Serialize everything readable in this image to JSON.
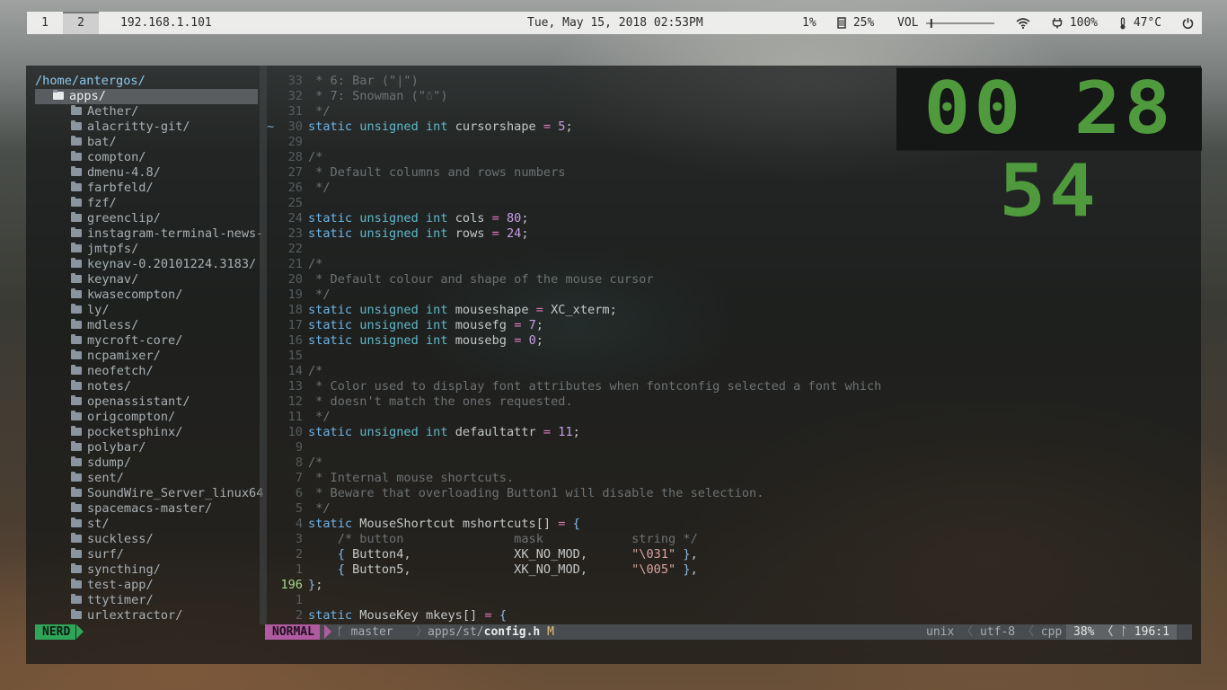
{
  "topbar": {
    "workspaces": [
      "1",
      "2"
    ],
    "active_workspace": "2",
    "ip": "192.168.1.101",
    "datetime": "Tue, May 15, 2018 02:53PM",
    "cpu": "1%",
    "memory": "25%",
    "volume_label": "VOL",
    "volume_level": 0.05,
    "battery": "100%",
    "temperature": "47°C"
  },
  "clock": {
    "time": "00 28 54"
  },
  "tree": {
    "root": "/home/antergos/",
    "selected": "apps/",
    "items": [
      "Aether/",
      "alacritty-git/",
      "bat/",
      "compton/",
      "dmenu-4.8/",
      "farbfeld/",
      "fzf/",
      "greenclip/",
      "instagram-terminal-news-",
      "jmtpfs/",
      "keynav-0.20101224.3183/",
      "keynav/",
      "kwasecompton/",
      "ly/",
      "mdless/",
      "mycroft-core/",
      "ncpamixer/",
      "neofetch/",
      "notes/",
      "openassistant/",
      "origcompton/",
      "pocketsphinx/",
      "polybar/",
      "sdump/",
      "sent/",
      "SoundWire_Server_linux64",
      "spacemacs-master/",
      "st/",
      "suckless/",
      "surf/",
      "syncthing/",
      "test-app/",
      "ttytimer/",
      "urlextractor/"
    ]
  },
  "editor": {
    "lines": [
      {
        "n": "33",
        "text": " * 6: Bar (\"|\")"
      },
      {
        "n": "32",
        "text": " * 7: Snowman (\"☃\")"
      },
      {
        "n": "31",
        "text": " */"
      },
      {
        "n": "30",
        "text": "static unsigned int cursorshape = 5;"
      },
      {
        "n": "29",
        "text": ""
      },
      {
        "n": "28",
        "text": "/*"
      },
      {
        "n": "27",
        "text": " * Default columns and rows numbers"
      },
      {
        "n": "26",
        "text": " */"
      },
      {
        "n": "25",
        "text": ""
      },
      {
        "n": "24",
        "text": "static unsigned int cols = 80;"
      },
      {
        "n": "23",
        "text": "static unsigned int rows = 24;"
      },
      {
        "n": "22",
        "text": ""
      },
      {
        "n": "21",
        "text": "/*"
      },
      {
        "n": "20",
        "text": " * Default colour and shape of the mouse cursor"
      },
      {
        "n": "19",
        "text": " */"
      },
      {
        "n": "18",
        "text": "static unsigned int mouseshape = XC_xterm;"
      },
      {
        "n": "17",
        "text": "static unsigned int mousefg = 7;"
      },
      {
        "n": "16",
        "text": "static unsigned int mousebg = 0;"
      },
      {
        "n": "15",
        "text": ""
      },
      {
        "n": "14",
        "text": "/*"
      },
      {
        "n": "13",
        "text": " * Color used to display font attributes when fontconfig selected a font which"
      },
      {
        "n": "12",
        "text": " * doesn't match the ones requested."
      },
      {
        "n": "11",
        "text": " */"
      },
      {
        "n": "10",
        "text": "static unsigned int defaultattr = 11;"
      },
      {
        "n": "9",
        "text": ""
      },
      {
        "n": "8",
        "text": "/*"
      },
      {
        "n": "7",
        "text": " * Internal mouse shortcuts."
      },
      {
        "n": "6",
        "text": " * Beware that overloading Button1 will disable the selection."
      },
      {
        "n": "5",
        "text": " */"
      },
      {
        "n": "4",
        "text": "static MouseShortcut mshortcuts[] = {"
      },
      {
        "n": "3",
        "text": "    /* button               mask            string */"
      },
      {
        "n": "2",
        "text": "    { Button4,              XK_NO_MOD,      \"\\031\" },"
      },
      {
        "n": "1",
        "text": "    { Button5,              XK_NO_MOD,      \"\\005\" },"
      },
      {
        "n": "196",
        "text": "};"
      },
      {
        "n": "1",
        "text": ""
      },
      {
        "n": "2",
        "text": "static MouseKey mkeys[] = {"
      }
    ],
    "change_marker": "~"
  },
  "status": {
    "tree_label": "NERD",
    "mode": "NORMAL",
    "branch": "master",
    "path_prefix": "apps/st/",
    "filename": "config.h",
    "modified": "M",
    "fileformat": "unix",
    "encoding": "utf-8",
    "filetype": "cpp",
    "percent": "38%",
    "position": "196:1"
  },
  "colors": {
    "clock_green": "#4f9a3c",
    "nerd_green": "#2fa55a",
    "mode_magenta": "#b05aa0"
  }
}
